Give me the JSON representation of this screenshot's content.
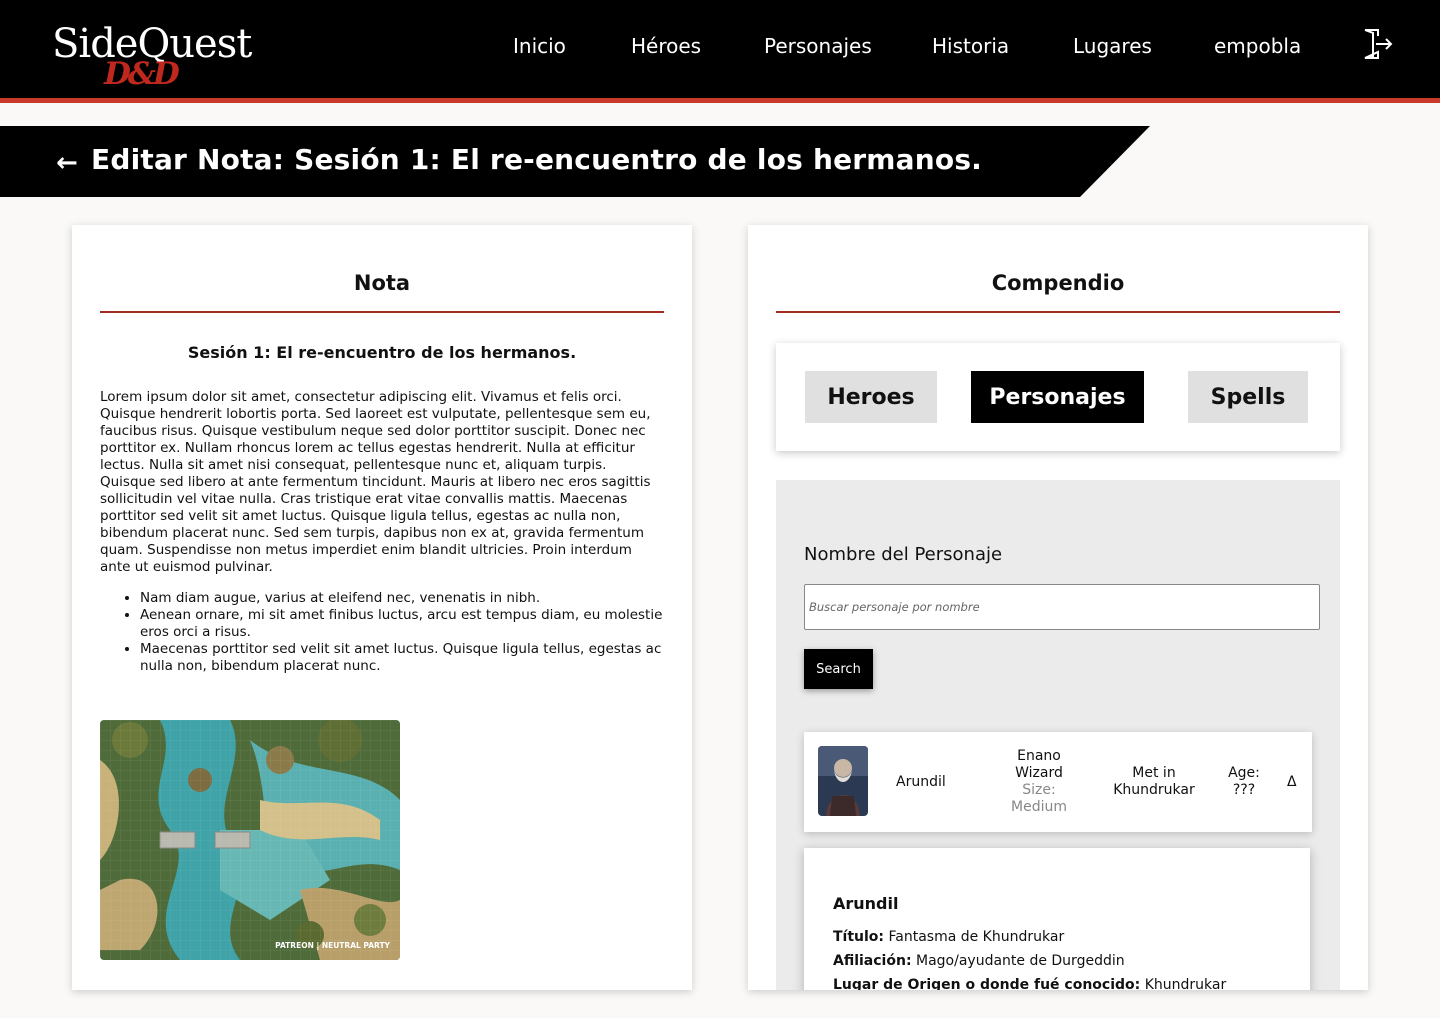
{
  "header": {
    "logo": {
      "main": "SideQuest",
      "sub": "D&D"
    },
    "nav": [
      "Inicio",
      "Héroes",
      "Personajes",
      "Historia",
      "Lugares",
      "empobla"
    ],
    "logout_icon": "logout-icon"
  },
  "banner": {
    "back_icon": "←",
    "title": "Editar Nota: Sesión 1: El re-encuentro de los hermanos."
  },
  "note_panel": {
    "heading": "Nota",
    "note_title": "Sesión 1: El re-encuentro de los hermanos.",
    "body": "Lorem ipsum dolor sit amet, consectetur adipiscing elit. Vivamus et felis orci. Quisque hendrerit lobortis porta. Sed laoreet est vulputate, pellentesque sem eu, faucibus risus. Quisque vestibulum neque sed dolor porttitor suscipit. Donec nec porttitor ex. Nullam rhoncus lorem ac tellus egestas hendrerit. Nulla at efficitur lectus. Nulla sit amet nisi consequat, pellentesque nunc et, aliquam turpis. Quisque sed libero at ante fermentum tincidunt. Mauris at libero nec eros sagittis sollicitudin vel vitae nulla. Cras tristique erat vitae convallis mattis. Maecenas porttitor sed velit sit amet luctus. Quisque ligula tellus, egestas ac nulla non, bibendum placerat nunc. Sed sem turpis, dapibus non ex at, gravida fermentum quam. Suspendisse non metus imperdiet enim blandit ultricies. Proin interdum ante ut euismod pulvinar.",
    "list": [
      "Nam diam augue, varius at eleifend nec, venenatis in nibh.",
      "Aenean ornare, mi sit amet finibus luctus, arcu est tempus diam, eu molestie eros orci a risus.",
      "Maecenas porttitor sed velit sit amet luctus. Quisque ligula tellus, egestas ac nulla non, bibendum placerat nunc."
    ],
    "map_caption": "PATREON | NEUTRAL PARTY"
  },
  "compendium": {
    "heading": "Compendio",
    "tabs": [
      "Heroes",
      "Personajes",
      "Spells"
    ],
    "active_tab": "Personajes",
    "search_label": "Nombre del Personaje",
    "search_placeholder": "Buscar personaje por nombre",
    "search_value": "",
    "search_button": "Search",
    "result": {
      "name": "Arundil",
      "race": "Enano",
      "class": "Wizard",
      "size_label": "Size:",
      "size_value": "Medium",
      "met_in": "Met in",
      "met_place": "Khundrukar",
      "age_label": "Age:",
      "age_value": "???",
      "toggle": "Δ"
    },
    "detail": {
      "name": "Arundil",
      "fields": [
        {
          "label": "Título:",
          "value": "Fantasma de Khundrukar"
        },
        {
          "label": "Afiliación:",
          "value": "Mago/ayudante de Durgeddin"
        },
        {
          "label": "Lugar de Origen o donde fué conocido:",
          "value": "Khundrukar"
        }
      ]
    }
  },
  "colors": {
    "accent": "#c83a2a",
    "rule": "#a02b1f",
    "black": "#000000"
  }
}
